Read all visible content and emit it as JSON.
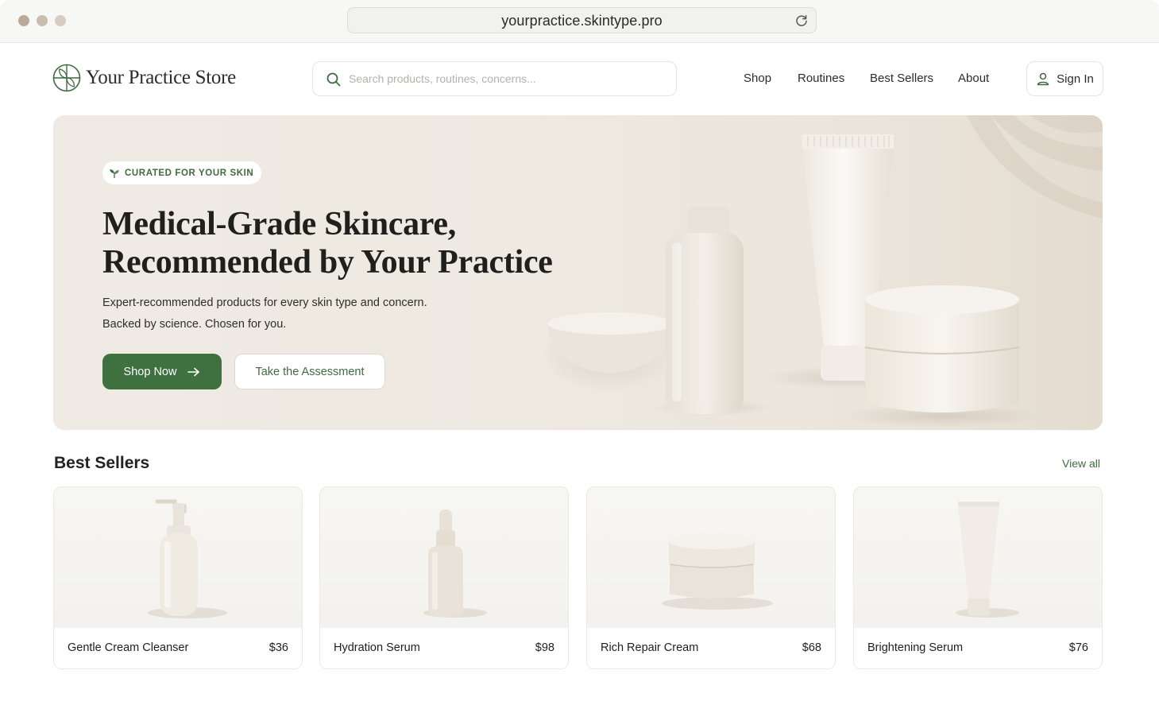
{
  "browser": {
    "url": "yourpractice.skintype.pro",
    "icons": {
      "reload": "reload-icon"
    }
  },
  "header": {
    "brand": "Your Practice Store",
    "search_placeholder": "Search products, routines, concerns...",
    "nav": [
      "Shop",
      "Routines",
      "Best Sellers",
      "About"
    ],
    "sign_in": "Sign In"
  },
  "hero": {
    "badge": "CURATED FOR YOUR SKIN",
    "headline_line1": "Medical-Grade Skincare,",
    "headline_line2": "Recommended by Your Practice",
    "subtext_line1": "Expert-recommended products for every skin type and concern.",
    "subtext_line2": "Backed by science. Chosen for you.",
    "primary_cta": "Shop Now",
    "secondary_cta": "Take the Assessment"
  },
  "best_sellers": {
    "title": "Best Sellers",
    "view_all": "View all",
    "products": [
      {
        "name": "Gentle Cream Cleanser",
        "price": "$36",
        "image": "pump-bottle"
      },
      {
        "name": "Hydration Serum",
        "price": "$98",
        "image": "dropper-bottle"
      },
      {
        "name": "Rich Repair Cream",
        "price": "$68",
        "image": "cream-jar"
      },
      {
        "name": "Brightening Serum",
        "price": "$76",
        "image": "tube"
      }
    ]
  },
  "colors": {
    "accent": "#3e7040",
    "hero_background": "#eee9e1",
    "text": "#1f1f1c"
  }
}
